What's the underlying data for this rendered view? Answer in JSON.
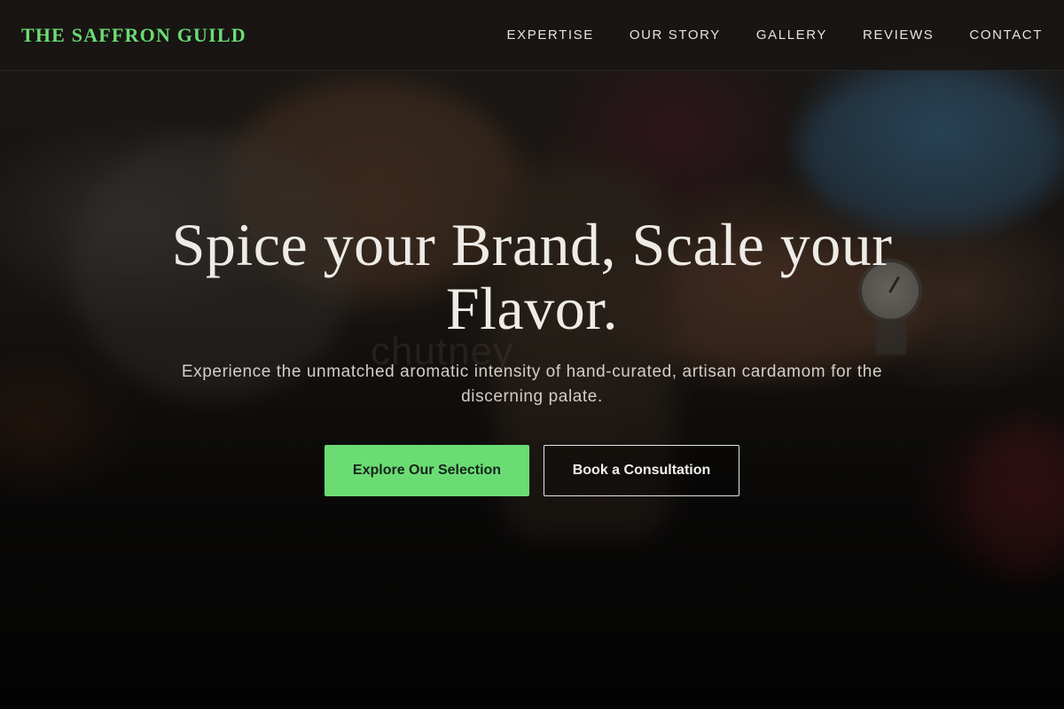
{
  "brand": {
    "name": "THE SAFFRON GUILD",
    "accent_color": "#6bdc74"
  },
  "nav": {
    "items": [
      {
        "label": "EXPERTISE"
      },
      {
        "label": "OUR STORY"
      },
      {
        "label": "GALLERY"
      },
      {
        "label": "REVIEWS"
      },
      {
        "label": "CONTACT"
      }
    ]
  },
  "hero": {
    "headline": "Spice your Brand, Scale your Flavor.",
    "subheadline": "Experience the unmatched aromatic intensity of hand-curated, artisan cardamom for the discerning palate.",
    "background_text": "chutney",
    "primary_cta": "Explore Our Selection",
    "secondary_cta": "Book a Consultation"
  },
  "colors": {
    "primary_button": "#6bdc74",
    "text_light": "#eeebe7",
    "overlay": "#000000"
  }
}
